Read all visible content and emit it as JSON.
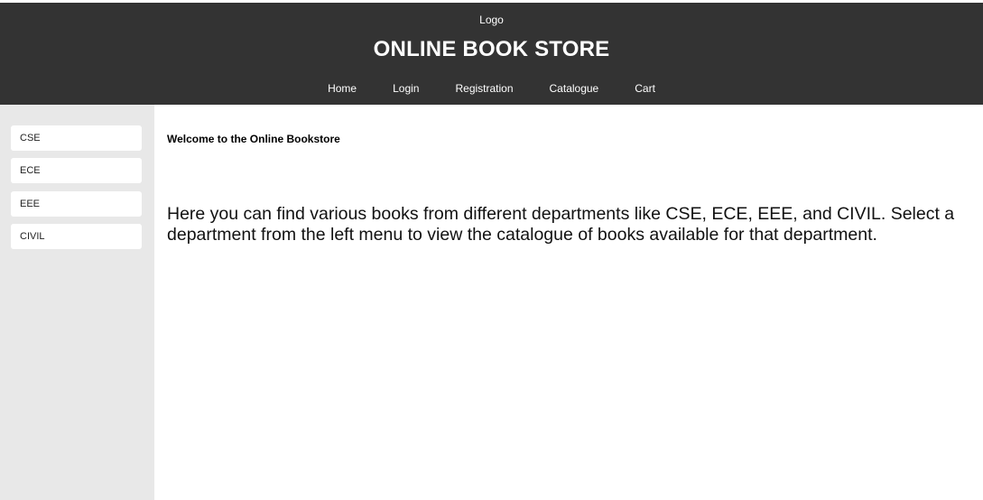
{
  "header": {
    "logo": "Logo",
    "title": "ONLINE BOOK STORE",
    "nav": [
      "Home",
      "Login",
      "Registration",
      "Catalogue",
      "Cart"
    ]
  },
  "sidebar": {
    "departments": [
      "CSE",
      "ECE",
      "EEE",
      "CIVIL"
    ]
  },
  "main": {
    "welcome": "Welcome to the Online Bookstore",
    "intro": "Here you can find various books from different departments like CSE, ECE, EEE, and CIVIL. Select a department from the left menu to view the catalogue of books available for that department."
  },
  "colors": {
    "header_bg": "#333333",
    "sidebar_bg": "#e8e8e8"
  }
}
